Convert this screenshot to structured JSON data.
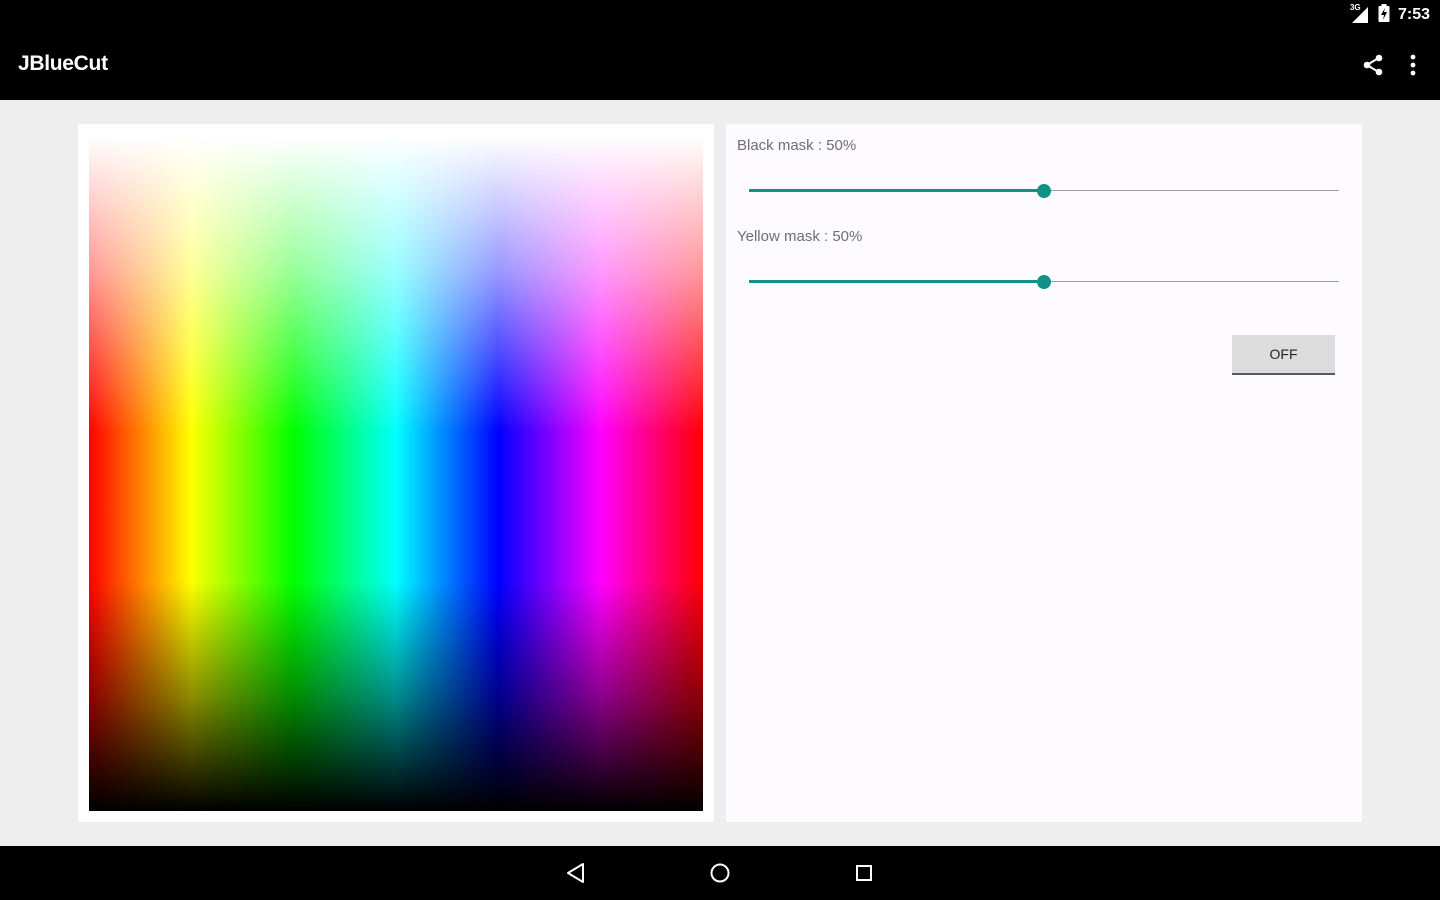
{
  "status_bar": {
    "time": "7:53",
    "network_label": "3G",
    "icons": [
      "signal-icon",
      "battery-charging-icon"
    ]
  },
  "app_bar": {
    "title": "JBlueCut",
    "actions": [
      "share-icon",
      "overflow-menu-icon"
    ]
  },
  "color_preview": {
    "hue_order": [
      "#ff0000",
      "#ffff00",
      "#00ff00",
      "#00ffff",
      "#0000ff",
      "#ff00ff",
      "#ff0000"
    ]
  },
  "controls": {
    "black_mask": {
      "label": "Black mask : 50%",
      "value": 50,
      "max": 100
    },
    "yellow_mask": {
      "label": "Yellow mask : 50%",
      "value": 50,
      "max": 100
    },
    "toggle_button": {
      "label": "OFF"
    }
  },
  "navigation_bar": {
    "buttons": [
      "back-icon",
      "home-icon",
      "recents-icon"
    ]
  },
  "colors": {
    "accent": "#139187",
    "app_bar": "#000000",
    "background": "#eeeeee"
  }
}
